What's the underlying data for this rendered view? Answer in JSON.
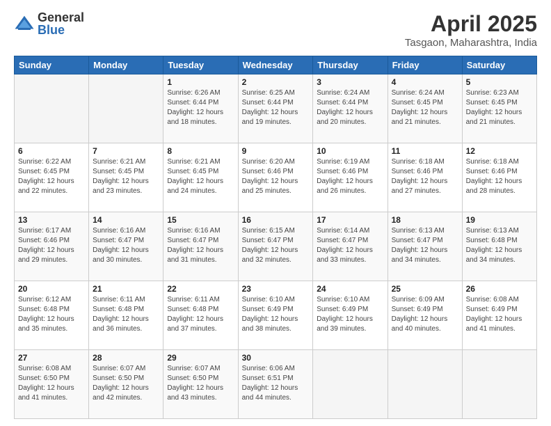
{
  "logo": {
    "general": "General",
    "blue": "Blue"
  },
  "title": "April 2025",
  "subtitle": "Tasgaon, Maharashtra, India",
  "days_of_week": [
    "Sunday",
    "Monday",
    "Tuesday",
    "Wednesday",
    "Thursday",
    "Friday",
    "Saturday"
  ],
  "weeks": [
    [
      {
        "day": "",
        "info": ""
      },
      {
        "day": "",
        "info": ""
      },
      {
        "day": "1",
        "info": "Sunrise: 6:26 AM\nSunset: 6:44 PM\nDaylight: 12 hours and 18 minutes."
      },
      {
        "day": "2",
        "info": "Sunrise: 6:25 AM\nSunset: 6:44 PM\nDaylight: 12 hours and 19 minutes."
      },
      {
        "day": "3",
        "info": "Sunrise: 6:24 AM\nSunset: 6:44 PM\nDaylight: 12 hours and 20 minutes."
      },
      {
        "day": "4",
        "info": "Sunrise: 6:24 AM\nSunset: 6:45 PM\nDaylight: 12 hours and 21 minutes."
      },
      {
        "day": "5",
        "info": "Sunrise: 6:23 AM\nSunset: 6:45 PM\nDaylight: 12 hours and 21 minutes."
      }
    ],
    [
      {
        "day": "6",
        "info": "Sunrise: 6:22 AM\nSunset: 6:45 PM\nDaylight: 12 hours and 22 minutes."
      },
      {
        "day": "7",
        "info": "Sunrise: 6:21 AM\nSunset: 6:45 PM\nDaylight: 12 hours and 23 minutes."
      },
      {
        "day": "8",
        "info": "Sunrise: 6:21 AM\nSunset: 6:45 PM\nDaylight: 12 hours and 24 minutes."
      },
      {
        "day": "9",
        "info": "Sunrise: 6:20 AM\nSunset: 6:46 PM\nDaylight: 12 hours and 25 minutes."
      },
      {
        "day": "10",
        "info": "Sunrise: 6:19 AM\nSunset: 6:46 PM\nDaylight: 12 hours and 26 minutes."
      },
      {
        "day": "11",
        "info": "Sunrise: 6:18 AM\nSunset: 6:46 PM\nDaylight: 12 hours and 27 minutes."
      },
      {
        "day": "12",
        "info": "Sunrise: 6:18 AM\nSunset: 6:46 PM\nDaylight: 12 hours and 28 minutes."
      }
    ],
    [
      {
        "day": "13",
        "info": "Sunrise: 6:17 AM\nSunset: 6:46 PM\nDaylight: 12 hours and 29 minutes."
      },
      {
        "day": "14",
        "info": "Sunrise: 6:16 AM\nSunset: 6:47 PM\nDaylight: 12 hours and 30 minutes."
      },
      {
        "day": "15",
        "info": "Sunrise: 6:16 AM\nSunset: 6:47 PM\nDaylight: 12 hours and 31 minutes."
      },
      {
        "day": "16",
        "info": "Sunrise: 6:15 AM\nSunset: 6:47 PM\nDaylight: 12 hours and 32 minutes."
      },
      {
        "day": "17",
        "info": "Sunrise: 6:14 AM\nSunset: 6:47 PM\nDaylight: 12 hours and 33 minutes."
      },
      {
        "day": "18",
        "info": "Sunrise: 6:13 AM\nSunset: 6:47 PM\nDaylight: 12 hours and 34 minutes."
      },
      {
        "day": "19",
        "info": "Sunrise: 6:13 AM\nSunset: 6:48 PM\nDaylight: 12 hours and 34 minutes."
      }
    ],
    [
      {
        "day": "20",
        "info": "Sunrise: 6:12 AM\nSunset: 6:48 PM\nDaylight: 12 hours and 35 minutes."
      },
      {
        "day": "21",
        "info": "Sunrise: 6:11 AM\nSunset: 6:48 PM\nDaylight: 12 hours and 36 minutes."
      },
      {
        "day": "22",
        "info": "Sunrise: 6:11 AM\nSunset: 6:48 PM\nDaylight: 12 hours and 37 minutes."
      },
      {
        "day": "23",
        "info": "Sunrise: 6:10 AM\nSunset: 6:49 PM\nDaylight: 12 hours and 38 minutes."
      },
      {
        "day": "24",
        "info": "Sunrise: 6:10 AM\nSunset: 6:49 PM\nDaylight: 12 hours and 39 minutes."
      },
      {
        "day": "25",
        "info": "Sunrise: 6:09 AM\nSunset: 6:49 PM\nDaylight: 12 hours and 40 minutes."
      },
      {
        "day": "26",
        "info": "Sunrise: 6:08 AM\nSunset: 6:49 PM\nDaylight: 12 hours and 41 minutes."
      }
    ],
    [
      {
        "day": "27",
        "info": "Sunrise: 6:08 AM\nSunset: 6:50 PM\nDaylight: 12 hours and 41 minutes."
      },
      {
        "day": "28",
        "info": "Sunrise: 6:07 AM\nSunset: 6:50 PM\nDaylight: 12 hours and 42 minutes."
      },
      {
        "day": "29",
        "info": "Sunrise: 6:07 AM\nSunset: 6:50 PM\nDaylight: 12 hours and 43 minutes."
      },
      {
        "day": "30",
        "info": "Sunrise: 6:06 AM\nSunset: 6:51 PM\nDaylight: 12 hours and 44 minutes."
      },
      {
        "day": "",
        "info": ""
      },
      {
        "day": "",
        "info": ""
      },
      {
        "day": "",
        "info": ""
      }
    ]
  ]
}
